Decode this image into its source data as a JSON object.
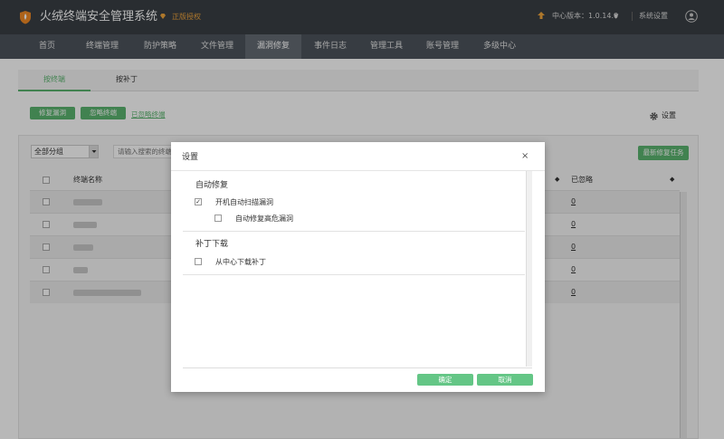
{
  "app": {
    "title": "火绒终端安全管理系统",
    "license": "正版授权",
    "version": "中心版本：1.0.14.0",
    "version_caret": "▼",
    "system_settings": "系统设置"
  },
  "nav": [
    "首页",
    "终端管理",
    "防护策略",
    "文件管理",
    "漏洞修复",
    "事件日志",
    "管理工具",
    "账号管理",
    "多级中心"
  ],
  "nav_active": "漏洞修复",
  "tabs": [
    "按终端",
    "按补丁"
  ],
  "actions": {
    "fix": "修复漏洞",
    "ignore": "忽略终端",
    "ignored_link": "已忽略终端",
    "settings": "设置"
  },
  "filter": {
    "group": "全部分组",
    "search_placeholder": "请输入搜索的终端",
    "latest_task": "最新修复任务"
  },
  "table": {
    "col_name": "终端名称",
    "col_ignored": "已忽略",
    "rows": [
      {
        "ignored": "0"
      },
      {
        "ignored": "0"
      },
      {
        "ignored": "0"
      },
      {
        "ignored": "0"
      },
      {
        "ignored": "0"
      }
    ]
  },
  "modal": {
    "title": "设置",
    "close": "×",
    "section1": "自动修复",
    "opt1": "开机自动扫描漏洞",
    "opt1_checked": "✓",
    "opt2": "自动修复高危漏洞",
    "section2": "补丁下载",
    "opt3": "从中心下载补丁",
    "confirm": "确定",
    "cancel": "取消"
  },
  "colors": {
    "accent": "#5bb56f",
    "topbar": "#3a3f45",
    "navbar": "#4d545c"
  }
}
